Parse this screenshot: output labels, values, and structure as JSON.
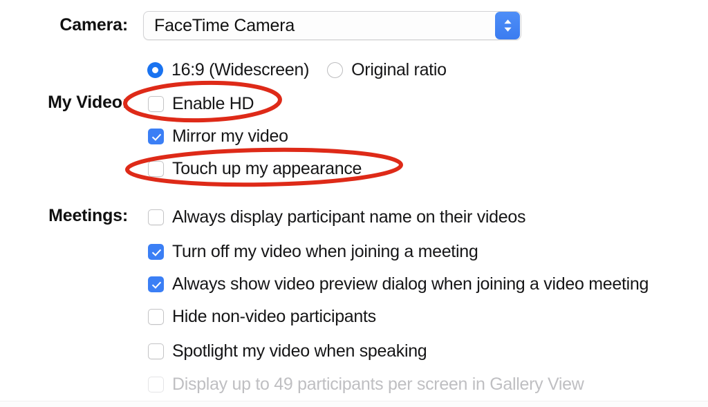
{
  "camera": {
    "label": "Camera:",
    "selected": "FaceTime Camera",
    "stepper_icon": "chevron-up-down-icon"
  },
  "aspect_ratio": {
    "options": [
      {
        "label": "16:9 (Widescreen)",
        "selected": true
      },
      {
        "label": "Original ratio",
        "selected": false
      }
    ]
  },
  "my_video": {
    "label": "My Video:",
    "options": [
      {
        "label": "Enable HD",
        "checked": false,
        "disabled": false,
        "annotated": true
      },
      {
        "label": "Mirror my video",
        "checked": true,
        "disabled": false,
        "annotated": false
      },
      {
        "label": "Touch up my appearance",
        "checked": false,
        "disabled": false,
        "annotated": true
      }
    ]
  },
  "meetings": {
    "label": "Meetings:",
    "options": [
      {
        "label": "Always display participant name on their videos",
        "checked": false,
        "disabled": false
      },
      {
        "label": "Turn off my video when joining a meeting",
        "checked": true,
        "disabled": false
      },
      {
        "label": "Always show video preview dialog when joining a video meeting",
        "checked": true,
        "disabled": false
      },
      {
        "label": "Hide non-video participants",
        "checked": false,
        "disabled": false
      },
      {
        "label": "Spotlight my video when speaking",
        "checked": false,
        "disabled": false
      },
      {
        "label": "Display up to 49 participants per screen in Gallery View",
        "checked": false,
        "disabled": true
      }
    ]
  },
  "annotations": {
    "color": "#de2a18",
    "items": [
      {
        "name": "enable-hd-highlight",
        "target": "Enable HD"
      },
      {
        "name": "touch-up-appearance-highlight",
        "target": "Touch up my appearance"
      }
    ]
  },
  "colors": {
    "accent_blue": "#3b7ff5",
    "radio_blue": "#1a73f0",
    "annotation_red": "#de2a18",
    "text": "#161617",
    "disabled_text": "#bfbfc2"
  }
}
